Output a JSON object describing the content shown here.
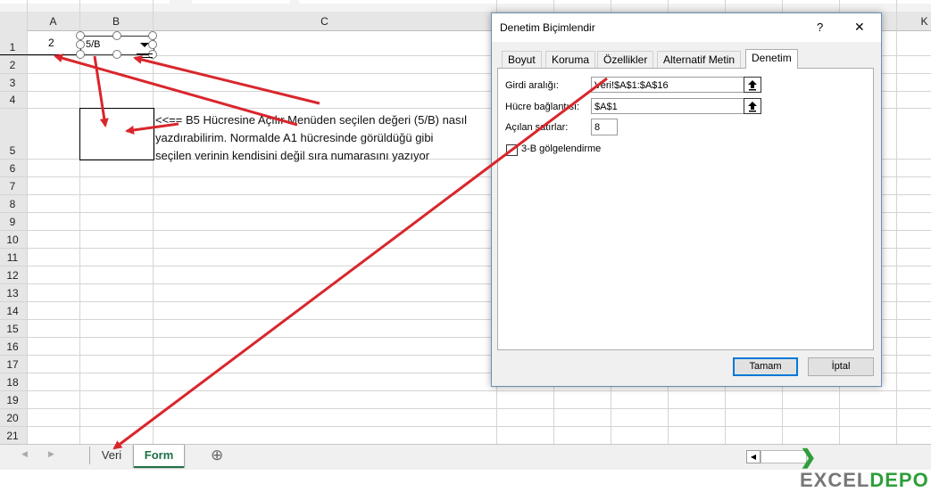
{
  "sheet": {
    "columns": [
      "A",
      "B",
      "C",
      "K"
    ],
    "rows": [
      "1",
      "2",
      "3",
      "4",
      "5",
      "6",
      "7",
      "8",
      "9",
      "10",
      "11",
      "12",
      "13",
      "14",
      "15",
      "16",
      "17",
      "18",
      "19",
      "20",
      "21"
    ],
    "cell_a1": "2",
    "dropdown_value": "5/B",
    "note_lines": [
      "<<== B5 Hücresine Açılır Menüden seçilen değeri (5/B) nasıl",
      "yazdırabilirim. Normalde A1 hücresinde görüldüğü gibi",
      "seçilen verinin kendisini değil sıra numarasını yazıyor"
    ]
  },
  "tabs": {
    "items": [
      "Veri",
      "Form"
    ],
    "active": "Form",
    "add_symbol": "⊕",
    "prev_symbol": "◀",
    "next_symbol": "▶"
  },
  "dialog": {
    "title": "Denetim Biçimlendir",
    "help_symbol": "?",
    "close_symbol": "✕",
    "tabs": [
      "Boyut",
      "Koruma",
      "Özellikler",
      "Alternatif Metin",
      "Denetim"
    ],
    "active_tab": "Denetim",
    "input_range_label": "Girdi aralığı:",
    "input_range_value": "Veri!$A$1:$A$16",
    "cell_link_label": "Hücre bağlantısı:",
    "cell_link_value": "$A$1",
    "dropdown_lines_label": "Açılan satırlar:",
    "dropdown_lines_value": "8",
    "shading_label": "3-B gölgelendirme",
    "shading_checked": false,
    "ok_label": "Tamam",
    "cancel_label": "İptal"
  },
  "watermark": {
    "text": "EXCEL DEPO"
  },
  "colors": {
    "arrow": "#d9262c",
    "active_tab_text": "#1e7145",
    "ok_border": "#0078d7"
  }
}
